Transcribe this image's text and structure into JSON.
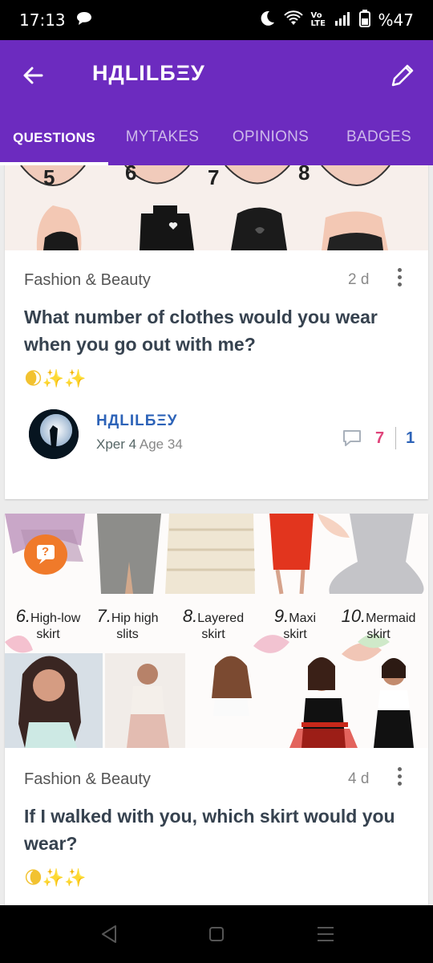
{
  "status": {
    "time": "17:13",
    "network": "Vo LTE",
    "battery": "%47"
  },
  "header": {
    "title": "НДLILБΞУ"
  },
  "tabs": [
    {
      "label": "QUESTIONS"
    },
    {
      "label": "MYTAKES"
    },
    {
      "label": "OPINIONS"
    },
    {
      "label": "BADGES"
    }
  ],
  "cards": [
    {
      "image_numbers": [
        "5",
        "6",
        "7",
        "8"
      ],
      "category": "Fashion & Beauty",
      "age": "2 d",
      "title": "What number of clothes would you wear when you go out with me?",
      "emoji": "🌒✨✨",
      "author": {
        "name": "НДLILБΞУ",
        "xper": "Xper 4",
        "age": "Age 34"
      },
      "comments": "7",
      "votes": "1"
    },
    {
      "image_labels": [
        {
          "num": "6.",
          "text": "High-low skirt"
        },
        {
          "num": "7.",
          "text": "Hip high slits"
        },
        {
          "num": "8.",
          "text": "Layered skirt"
        },
        {
          "num": "9.",
          "text": "Maxi skirt"
        },
        {
          "num": "10.",
          "text": "Mermaid skirt"
        }
      ],
      "badge": "?",
      "category": "Fashion & Beauty",
      "age": "4 d",
      "title": "If I walked with you, which skirt would you wear?",
      "emoji": "🌘✨✨"
    }
  ],
  "colors": {
    "appbar": "#6c2bbf",
    "author": "#2d63b8",
    "comments": "#e0457b",
    "votes": "#2d63b8",
    "badge": "#f07a2a"
  }
}
